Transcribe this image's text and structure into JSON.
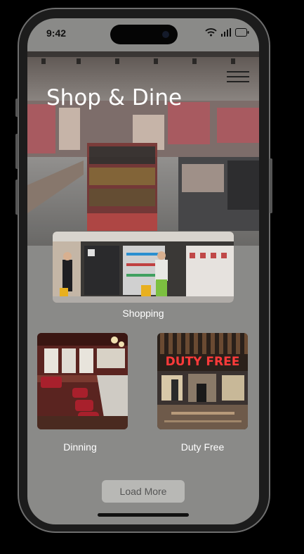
{
  "status_bar": {
    "time": "9:42"
  },
  "hero": {
    "title": "Shop & Dine"
  },
  "categories": [
    {
      "label": "Shopping"
    },
    {
      "label": "Dinning"
    },
    {
      "label": "Duty Free",
      "sign_text": "DUTY FREE"
    }
  ],
  "actions": {
    "load_more": "Load More"
  }
}
